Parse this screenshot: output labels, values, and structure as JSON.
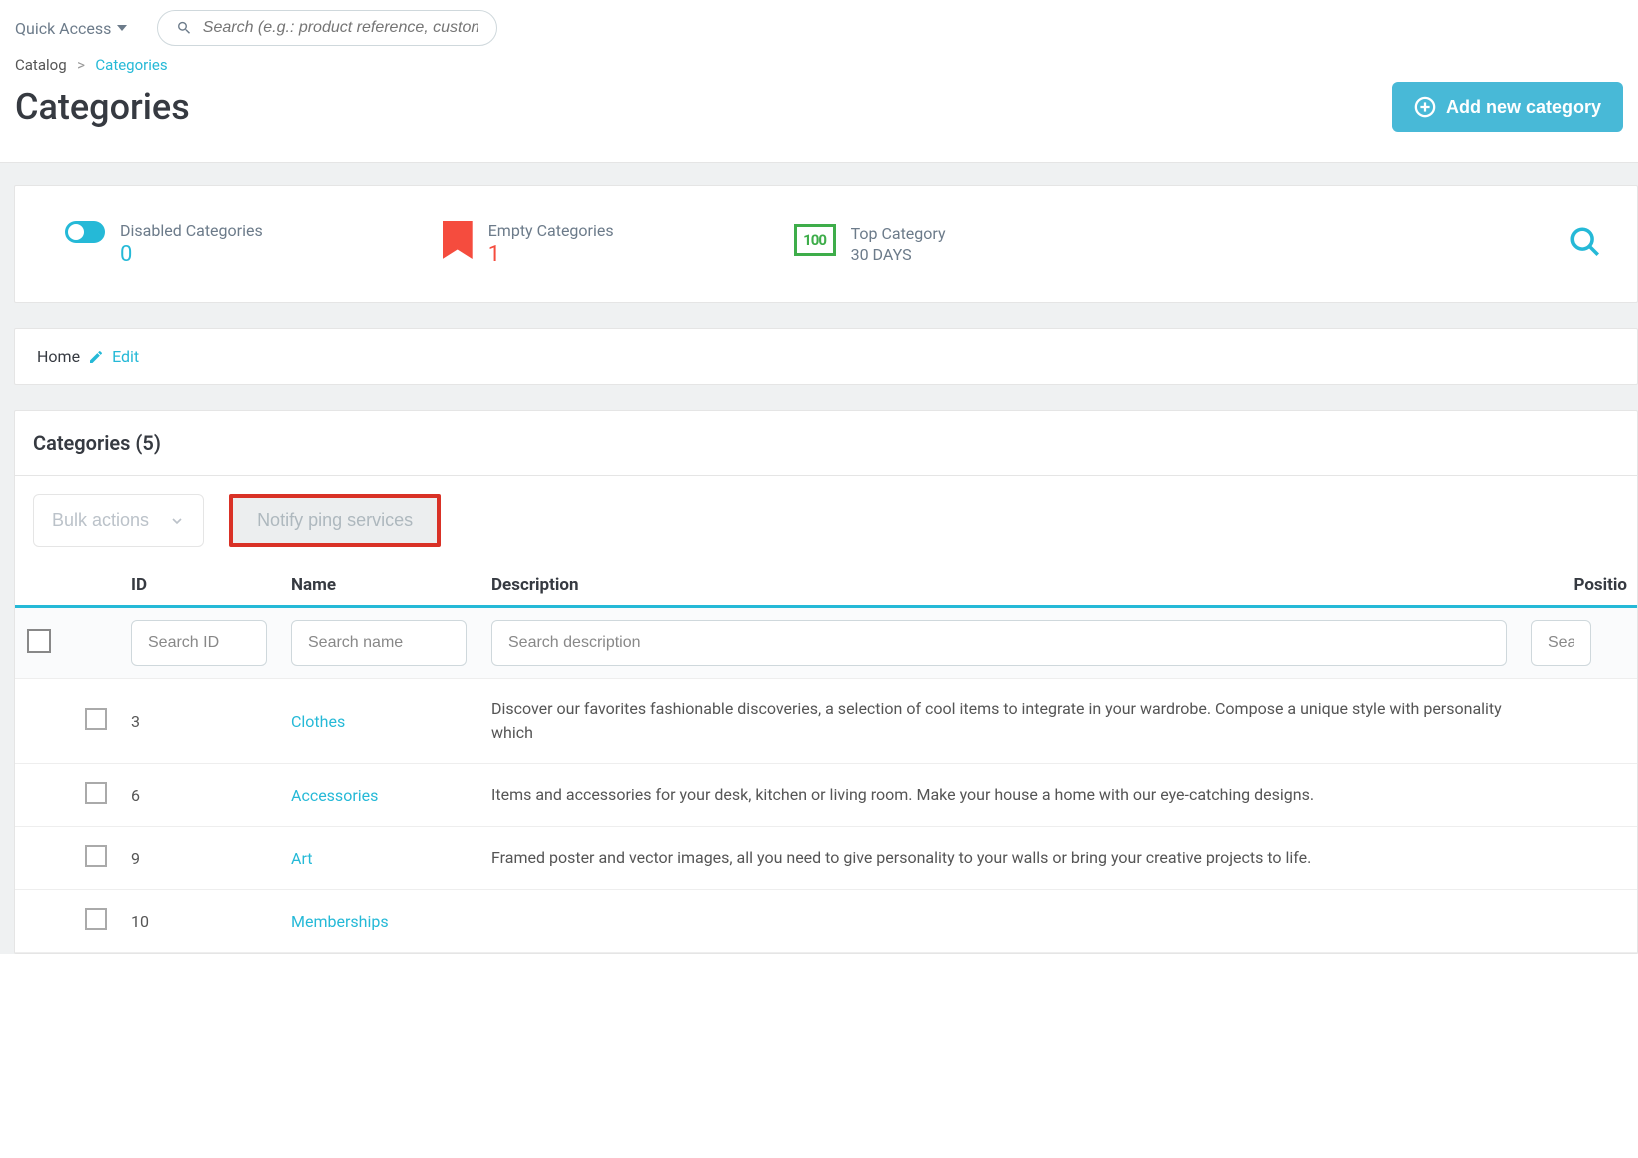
{
  "topbar": {
    "quick_access": "Quick Access",
    "search_placeholder": "Search (e.g.: product reference, custom"
  },
  "breadcrumb": {
    "parent": "Catalog",
    "current": "Categories"
  },
  "page": {
    "title": "Categories",
    "add_button": "Add new category"
  },
  "stats": {
    "disabled": {
      "label": "Disabled Categories",
      "value": "0"
    },
    "empty": {
      "label": "Empty Categories",
      "value": "1"
    },
    "top": {
      "label": "Top Category",
      "sub": "30 DAYS",
      "icon_text": "100"
    }
  },
  "home_bar": {
    "home": "Home",
    "edit": "Edit"
  },
  "table": {
    "title_prefix": "Categories",
    "count": "5",
    "bulk_label": "Bulk actions",
    "notify_label": "Notify ping services",
    "headers": {
      "id": "ID",
      "name": "Name",
      "description": "Description",
      "position": "Positio"
    },
    "filters": {
      "id_ph": "Search ID",
      "name_ph": "Search name",
      "desc_ph": "Search description",
      "pos_ph": "Sea"
    },
    "rows": [
      {
        "id": "3",
        "name": "Clothes",
        "desc": "Discover our favorites fashionable discoveries, a selection of cool items to integrate in your wardrobe. Compose a unique style with personality which"
      },
      {
        "id": "6",
        "name": "Accessories",
        "desc": "Items and accessories for your desk, kitchen or living room. Make your house a home with our eye-catching designs."
      },
      {
        "id": "9",
        "name": "Art",
        "desc": "Framed poster and vector images, all you need to give personality to your walls or bring your creative projects to life."
      },
      {
        "id": "10",
        "name": "Memberships",
        "desc": ""
      }
    ]
  }
}
